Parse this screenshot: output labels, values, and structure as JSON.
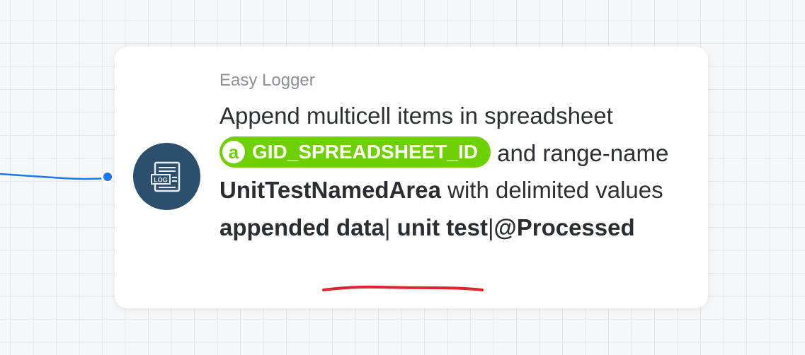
{
  "colors": {
    "canvas_bg": "#f6f7f9",
    "grid": "#e4e6ea",
    "connector": "#1976f5",
    "icon_bg": "#2d4f6e",
    "pill_bg": "#6fd000",
    "underline": "#e0232d"
  },
  "node": {
    "icon_name": "log-file-icon",
    "icon_glyph_text": "LOG",
    "app_name": "Easy Logger",
    "text_1": "Append multicell items in spreadsheet",
    "variable": {
      "icon_glyph": "a",
      "label": "GID_SPREADSHEET_ID"
    },
    "text_2": "and range-name",
    "range_name": "UnitTestNamedArea",
    "text_3": "with delimited values",
    "value_part_1": "appended data",
    "separator_1": "|",
    "value_part_2": "unit test",
    "separator_2": "|",
    "value_part_3": "@Processed"
  }
}
